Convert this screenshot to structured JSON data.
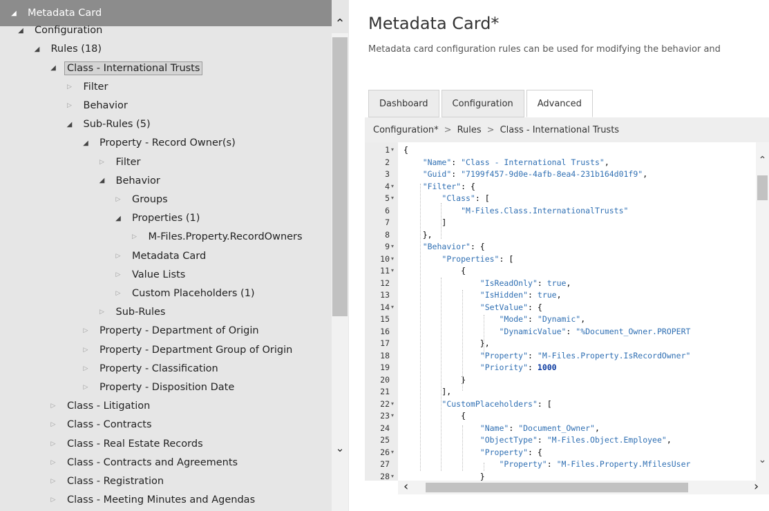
{
  "tree": {
    "nodes": [
      {
        "label": "Metadata Card",
        "depth": 0,
        "expanded": true
      },
      {
        "label": "Configuration",
        "depth": 1,
        "expanded": true
      },
      {
        "label": "Rules (18)",
        "depth": 2,
        "expanded": true
      },
      {
        "label": "Class - International Trusts",
        "depth": 3,
        "expanded": true,
        "selected": true
      },
      {
        "label": "Filter",
        "depth": 4,
        "expanded": false
      },
      {
        "label": "Behavior",
        "depth": 4,
        "expanded": false
      },
      {
        "label": "Sub-Rules (5)",
        "depth": 4,
        "expanded": true
      },
      {
        "label": "Property - Record Owner(s)",
        "depth": 5,
        "expanded": true
      },
      {
        "label": "Filter",
        "depth": 6,
        "expanded": false
      },
      {
        "label": "Behavior",
        "depth": 6,
        "expanded": true
      },
      {
        "label": "Groups",
        "depth": 7,
        "expanded": false
      },
      {
        "label": "Properties (1)",
        "depth": 7,
        "expanded": true
      },
      {
        "label": "M-Files.Property.RecordOwners",
        "depth": 8,
        "expanded": false
      },
      {
        "label": "Metadata Card",
        "depth": 7,
        "expanded": false
      },
      {
        "label": "Value Lists",
        "depth": 7,
        "expanded": false
      },
      {
        "label": "Custom Placeholders (1)",
        "depth": 7,
        "expanded": false
      },
      {
        "label": "Sub-Rules",
        "depth": 6,
        "expanded": false
      },
      {
        "label": "Property - Department of Origin",
        "depth": 5,
        "expanded": false
      },
      {
        "label": "Property - Department Group of Origin",
        "depth": 5,
        "expanded": false
      },
      {
        "label": "Property - Classification",
        "depth": 5,
        "expanded": false
      },
      {
        "label": "Property - Disposition Date",
        "depth": 5,
        "expanded": false
      },
      {
        "label": "Class - Litigation",
        "depth": 3,
        "expanded": false
      },
      {
        "label": "Class - Contracts",
        "depth": 3,
        "expanded": false
      },
      {
        "label": "Class - Real Estate Records",
        "depth": 3,
        "expanded": false
      },
      {
        "label": "Class - Contracts and Agreements",
        "depth": 3,
        "expanded": false
      },
      {
        "label": "Class - Registration",
        "depth": 3,
        "expanded": false
      },
      {
        "label": "Class - Meeting Minutes and Agendas",
        "depth": 3,
        "expanded": false
      }
    ]
  },
  "main": {
    "title": "Metadata Card*",
    "description": "Metadata card configuration rules can be used for modifying the behavior and",
    "tabs": [
      {
        "label": "Dashboard",
        "active": false
      },
      {
        "label": "Configuration",
        "active": false
      },
      {
        "label": "Advanced",
        "active": true
      }
    ],
    "breadcrumb": [
      "Configuration*",
      "Rules",
      "Class - International Trusts"
    ],
    "breadcrumb_separator": ">"
  },
  "editor": {
    "lines": [
      {
        "n": "1",
        "fold": true,
        "text": "{"
      },
      {
        "n": "2",
        "fold": false,
        "text": "    \"Name\": \"Class - International Trusts\","
      },
      {
        "n": "3",
        "fold": false,
        "text": "    \"Guid\": \"7199f457-9d0e-4afb-8ea4-231b164d01f9\","
      },
      {
        "n": "4",
        "fold": true,
        "text": "    \"Filter\": {"
      },
      {
        "n": "5",
        "fold": true,
        "text": "        \"Class\": ["
      },
      {
        "n": "6",
        "fold": false,
        "text": "            \"M-Files.Class.InternationalTrusts\""
      },
      {
        "n": "7",
        "fold": false,
        "text": "        ]"
      },
      {
        "n": "8",
        "fold": false,
        "text": "    },"
      },
      {
        "n": "9",
        "fold": true,
        "text": "    \"Behavior\": {"
      },
      {
        "n": "10",
        "fold": true,
        "text": "        \"Properties\": ["
      },
      {
        "n": "11",
        "fold": true,
        "text": "            {"
      },
      {
        "n": "12",
        "fold": false,
        "text": "                \"IsReadOnly\": true,"
      },
      {
        "n": "13",
        "fold": false,
        "text": "                \"IsHidden\": true,"
      },
      {
        "n": "14",
        "fold": true,
        "text": "                \"SetValue\": {"
      },
      {
        "n": "15",
        "fold": false,
        "text": "                    \"Mode\": \"Dynamic\","
      },
      {
        "n": "16",
        "fold": false,
        "text": "                    \"DynamicValue\": \"%Document_Owner.PROPERT"
      },
      {
        "n": "17",
        "fold": false,
        "text": "                },"
      },
      {
        "n": "18",
        "fold": false,
        "text": "                \"Property\": \"M-Files.Property.IsRecordOwner\""
      },
      {
        "n": "19",
        "fold": false,
        "text": "                \"Priority\": 1000"
      },
      {
        "n": "20",
        "fold": false,
        "text": "            }"
      },
      {
        "n": "21",
        "fold": false,
        "text": "        ],"
      },
      {
        "n": "22",
        "fold": true,
        "text": "        \"CustomPlaceholders\": ["
      },
      {
        "n": "23",
        "fold": true,
        "text": "            {"
      },
      {
        "n": "24",
        "fold": false,
        "text": "                \"Name\": \"Document_Owner\","
      },
      {
        "n": "25",
        "fold": false,
        "text": "                \"ObjectType\": \"M-Files.Object.Employee\","
      },
      {
        "n": "26",
        "fold": true,
        "text": "                \"Property\": {"
      },
      {
        "n": "27",
        "fold": false,
        "text": "                    \"Property\": \"M-Files.Property.MfilesUser"
      },
      {
        "n": "28",
        "fold": true,
        "text": "                }"
      }
    ]
  },
  "icons": {
    "expanded": "triangle-expanded-icon",
    "collapsed": "triangle-collapsed-icon",
    "fold": "fold-arrow-icon"
  },
  "colors": {
    "tree_bg": "#e6e6e6",
    "root_bg": "#8c8c8c",
    "code_string": "#2f6fb3",
    "code_number": "#0b3aa0"
  }
}
